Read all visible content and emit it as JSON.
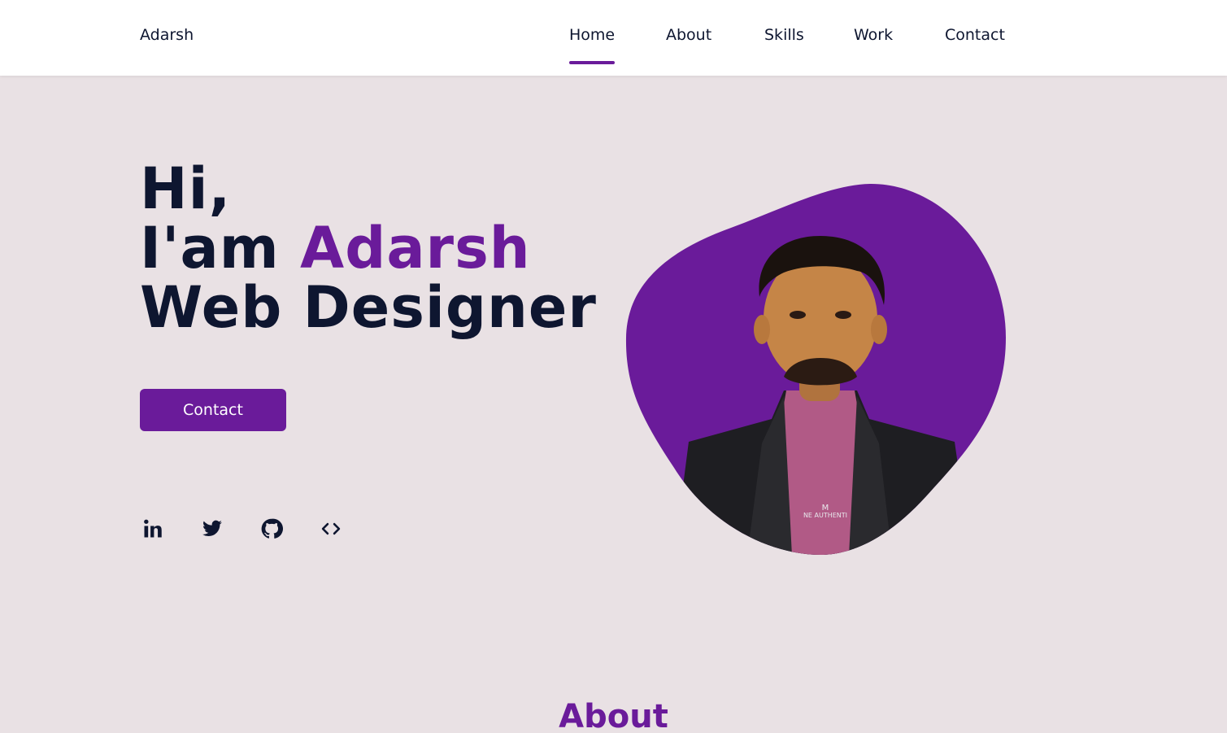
{
  "header": {
    "logo": "Adarsh",
    "nav": [
      {
        "label": "Home",
        "active": true
      },
      {
        "label": "About",
        "active": false
      },
      {
        "label": "Skills",
        "active": false
      },
      {
        "label": "Work",
        "active": false
      },
      {
        "label": "Contact",
        "active": false
      }
    ]
  },
  "hero": {
    "greeting": "Hi,",
    "intro_prefix": "I'am ",
    "name": "Adarsh",
    "role": "Web Designer",
    "cta_label": "Contact",
    "socials": [
      {
        "icon": "linkedin-icon"
      },
      {
        "icon": "twitter-icon"
      },
      {
        "icon": "github-icon"
      },
      {
        "icon": "code-icon"
      }
    ],
    "shirt_text": "M",
    "shirt_subtext": "NE AUTHENTI"
  },
  "about": {
    "title": "About"
  },
  "colors": {
    "accent": "#6a1b9a",
    "text": "#0e1630",
    "background": "#e9e1e4",
    "header_bg": "#ffffff"
  }
}
